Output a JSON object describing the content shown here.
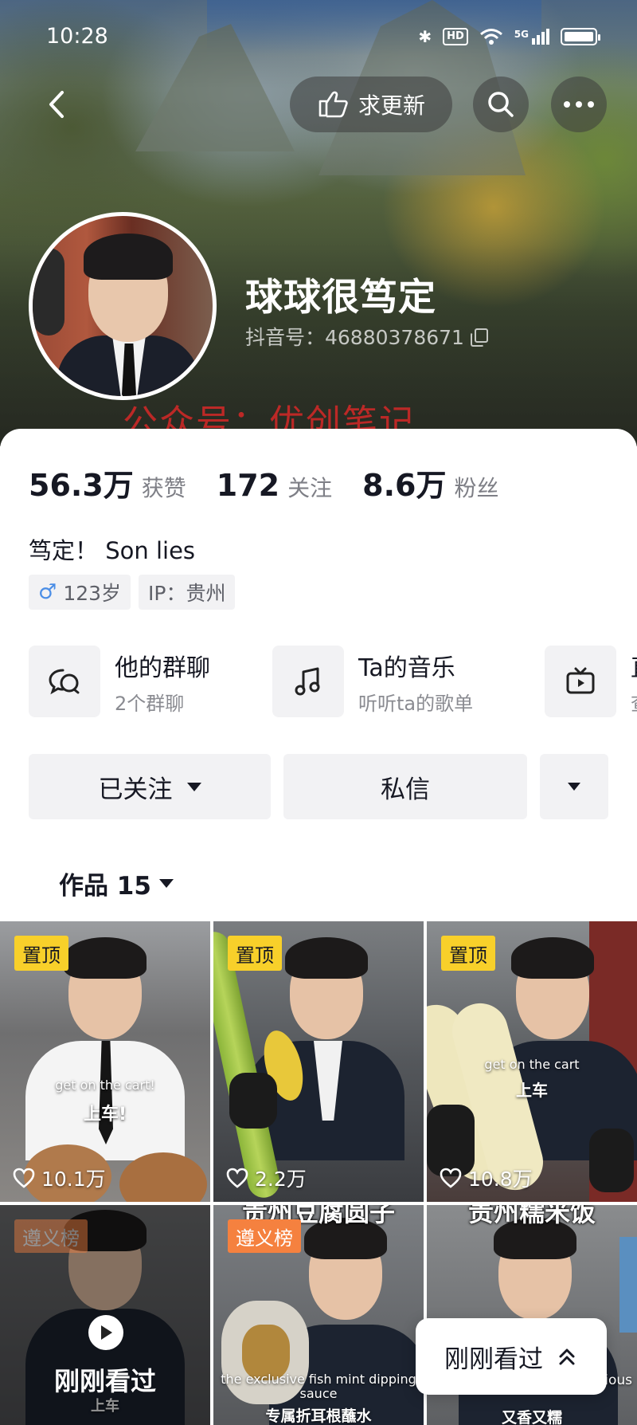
{
  "status_bar": {
    "time": "10:28",
    "hd": "HD",
    "network": "5G"
  },
  "top_nav": {
    "request_update": "求更新"
  },
  "profile": {
    "nickname": "球球很笃定",
    "douyin_id": "抖音号：46880378671",
    "watermark": "公众号：优创笔记"
  },
  "stats": [
    {
      "value": "56.3万",
      "label": "获赞"
    },
    {
      "value": "172",
      "label": "关注"
    },
    {
      "value": "8.6万",
      "label": "粉丝"
    }
  ],
  "bio": "笃定！ Son lies",
  "tags": {
    "age": "123岁",
    "ip": "IP：贵州",
    "gender_icon": "male-icon"
  },
  "features": [
    {
      "title": "他的群聊",
      "subtitle": "2个群聊",
      "icon": "chat-icon"
    },
    {
      "title": "Ta的音乐",
      "subtitle": "听听ta的歌单",
      "icon": "music-icon"
    },
    {
      "title": "直",
      "subtitle": "查",
      "icon": "tv-icon"
    }
  ],
  "actions": {
    "followed": "已关注",
    "message": "私信"
  },
  "works_tab": {
    "label": "作品 15"
  },
  "videos": [
    {
      "badge": "置顶",
      "caption_en": "get on the cart!",
      "caption_zh": "上车!",
      "likes": "10.1万"
    },
    {
      "badge": "置顶",
      "likes": "2.2万"
    },
    {
      "badge": "置顶",
      "caption_en": "get on the cart",
      "caption_zh": "上车",
      "likes": "10.8万"
    },
    {
      "badge": "遵义榜",
      "caption_zh": "上车",
      "recent": "刚刚看过"
    },
    {
      "badge": "遵义榜",
      "title": "贵州豆腐圆子",
      "caption_en": "the exclusive fish mint dipping sauce",
      "caption_zh": "专属折耳根蘸水"
    },
    {
      "title": "贵州糯米饭",
      "caption_en": "ious",
      "caption_zh": "又香又糯"
    }
  ],
  "floating": {
    "recent_label": "刚刚看过"
  },
  "colors": {
    "badge_pin": "#f8d02a",
    "badge_rank": "#f5813f",
    "watermark": "#e62828"
  }
}
